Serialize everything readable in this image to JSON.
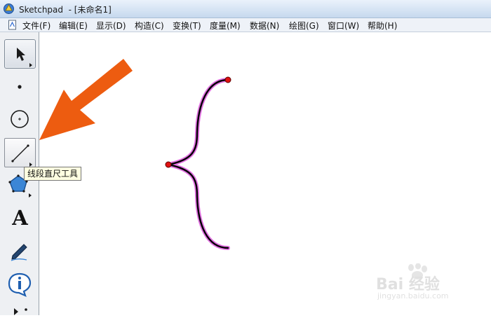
{
  "window": {
    "app_name": "Sketchpad",
    "title": "Sketchpad  - [未命名1]"
  },
  "menu": [
    {
      "label": "文件(F)"
    },
    {
      "label": "编辑(E)"
    },
    {
      "label": "显示(D)"
    },
    {
      "label": "构造(C)"
    },
    {
      "label": "变换(T)"
    },
    {
      "label": "度量(M)"
    },
    {
      "label": "数据(N)"
    },
    {
      "label": "绘图(G)"
    },
    {
      "label": "窗口(W)"
    },
    {
      "label": "帮助(H)"
    }
  ],
  "toolbox": {
    "tools": [
      {
        "name": "arrow-select-tool",
        "icon": "arrow-cursor-icon",
        "selected": true
      },
      {
        "name": "point-tool",
        "icon": "point-icon"
      },
      {
        "name": "compass-tool",
        "icon": "circle-icon"
      },
      {
        "name": "straightedge-tool",
        "icon": "line-segment-icon",
        "hovered": true
      },
      {
        "name": "polygon-tool",
        "icon": "pentagon-icon"
      },
      {
        "name": "text-tool",
        "icon": "letter-a-icon",
        "letter": "A"
      },
      {
        "name": "marker-tool",
        "icon": "pen-icon"
      },
      {
        "name": "information-tool",
        "icon": "info-icon"
      },
      {
        "name": "custom-tool",
        "icon": "custom-tool-icon"
      }
    ],
    "tooltip": "线段直尺工具"
  },
  "annotation": {
    "arrow_color": "#ed5c10",
    "icon": "orange-pointer-arrow-icon"
  },
  "canvas": {
    "curve_color": "#000000",
    "highlight_color": "#e070e0",
    "point_color": "#e01010",
    "shape": "curly-brace"
  },
  "watermark": {
    "brand": "Bai 经验",
    "url": "jingyan.baidu.com"
  }
}
